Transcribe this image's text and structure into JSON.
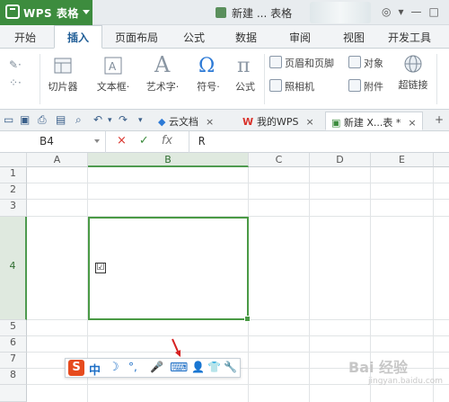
{
  "app": {
    "name": "WPS 表格",
    "doc_title": "新建 ... 表格"
  },
  "ribbon_tabs": [
    "开始",
    "插入",
    "页面布局",
    "公式",
    "数据",
    "审阅",
    "视图",
    "开发工具"
  ],
  "active_tab": "插入",
  "ribbon": {
    "picture_button": "切片器",
    "textbox": "文本框·",
    "wordart": "艺术字·",
    "symbol": "符号·",
    "formula": "公式",
    "header_footer": "页眉和页脚",
    "object": "对象",
    "camera": "照相机",
    "attachment": "附件",
    "hyperlink": "超链接"
  },
  "doc_tabs": [
    {
      "label": "云文档",
      "close": "×"
    },
    {
      "label": "我的WPS",
      "close": "×"
    },
    {
      "label": "新建 X...表 *",
      "close": "×"
    }
  ],
  "new_tab": "+",
  "formula_bar": {
    "cell_ref": "B4",
    "cancel": "×",
    "confirm": "✓",
    "fx": "fx",
    "value": "R"
  },
  "columns": [
    "A",
    "B",
    "C",
    "D",
    "E"
  ],
  "rows": [
    "1",
    "2",
    "3",
    "4",
    "5",
    "6",
    "7",
    "8"
  ],
  "selected_cell": {
    "col": "B",
    "row": "4",
    "content": "☑"
  },
  "ime_toolbar": {
    "logo": "S",
    "mode": "中",
    "items": [
      "☽",
      "°,",
      "🎤",
      "⌨",
      "👤",
      "👕",
      "🔧"
    ]
  },
  "watermark": {
    "main": "Bai 经验",
    "sub": "jingyan.baidu.com"
  },
  "colors": {
    "brand": "#3d8c3e",
    "selection": "#4a9a45",
    "ime_logo": "#e64b1e"
  }
}
